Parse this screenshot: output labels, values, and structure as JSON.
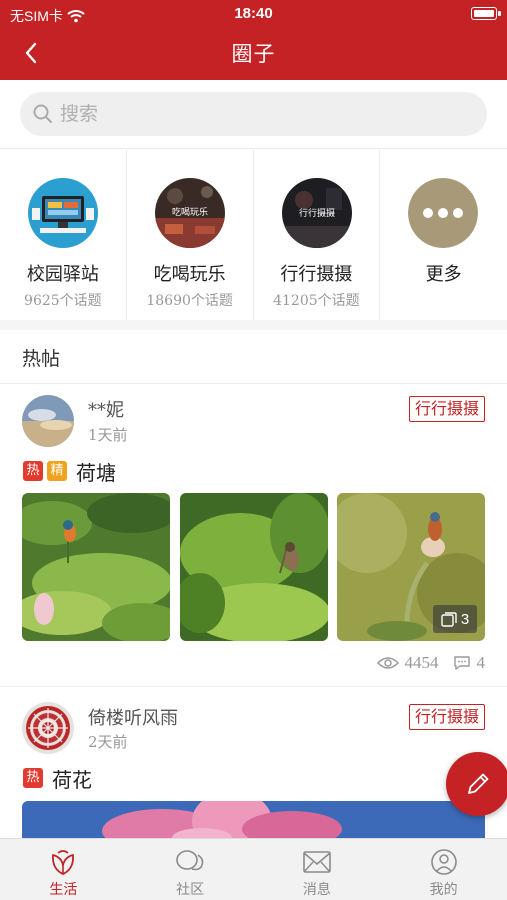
{
  "status": {
    "carrier": "无SIM卡",
    "time": "18:40"
  },
  "header": {
    "title": "圈子"
  },
  "search": {
    "placeholder": "搜索"
  },
  "categories": [
    {
      "name": "校园驿站",
      "count": "9625个话题"
    },
    {
      "name": "吃喝玩乐",
      "count": "18690个话题",
      "image_text": "吃喝玩乐"
    },
    {
      "name": "行行摄摄",
      "count": "41205个话题",
      "image_text": "行行摄摄"
    },
    {
      "name": "更多",
      "count": ""
    }
  ],
  "section": {
    "title": "热帖"
  },
  "posts": [
    {
      "author": "**妮",
      "time": "1天前",
      "tag": "行行摄摄",
      "badges": [
        "热",
        "精"
      ],
      "title": "荷塘",
      "more_images": "3",
      "views": "4454",
      "comments": "4"
    },
    {
      "author": "倚楼听风雨",
      "time": "2天前",
      "tag": "行行摄摄",
      "badges": [
        "热"
      ],
      "title": "荷花"
    }
  ],
  "tabs": [
    {
      "label": "生活",
      "icon": "leaf-icon",
      "active": true
    },
    {
      "label": "社区",
      "icon": "chat-bubbles-icon",
      "active": false
    },
    {
      "label": "消息",
      "icon": "envelope-icon",
      "active": false
    },
    {
      "label": "我的",
      "icon": "profile-icon",
      "active": false
    }
  ],
  "colors": {
    "brand": "#c42224",
    "hot": "#e23a2e",
    "best": "#f1a21c"
  }
}
